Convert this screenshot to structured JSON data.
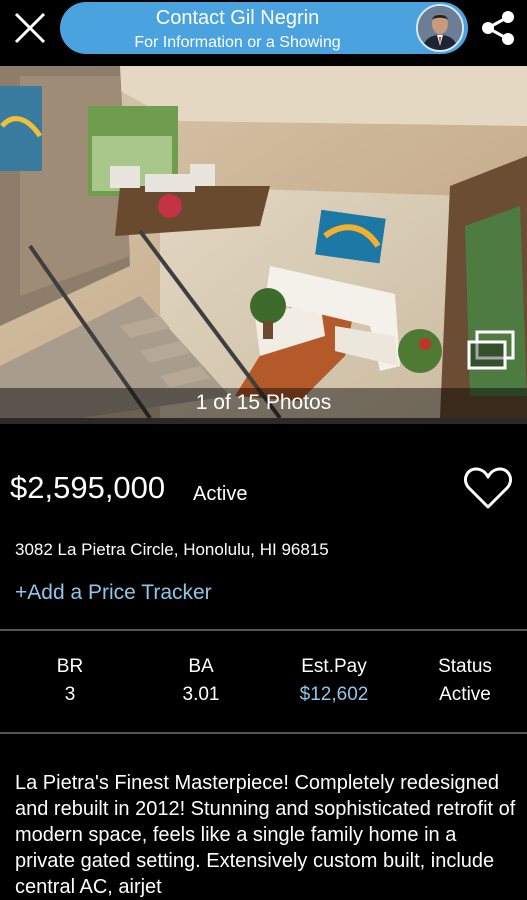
{
  "header": {
    "contact_title": "Contact Gil Negrin",
    "contact_subtitle": "For Information or a Showing"
  },
  "photo": {
    "caption": "1 of 15 Photos"
  },
  "listing": {
    "price": "$2,595,000",
    "status": "Active",
    "address": "3082 La Pietra Circle, Honolulu, HI 96815",
    "price_tracker": "+Add a Price Tracker"
  },
  "stats": [
    {
      "label": "BR",
      "value": "3"
    },
    {
      "label": "BA",
      "value": "3.01"
    },
    {
      "label": "Est.Pay",
      "value": "$12,602"
    },
    {
      "label": "Status",
      "value": "Active"
    }
  ],
  "description": "La Pietra's Finest Masterpiece!  Completely redesigned and rebuilt in 2012!  Stunning and sophisticated retrofit of modern space, feels like a single family home in a private gated setting. Extensively custom built, include central AC, airjet",
  "colors": {
    "accent": "#4aa3df",
    "link": "#8fc6ea",
    "background": "#000000"
  },
  "icons": [
    "close-icon",
    "share-icon",
    "heart-icon",
    "gallery-icon"
  ]
}
